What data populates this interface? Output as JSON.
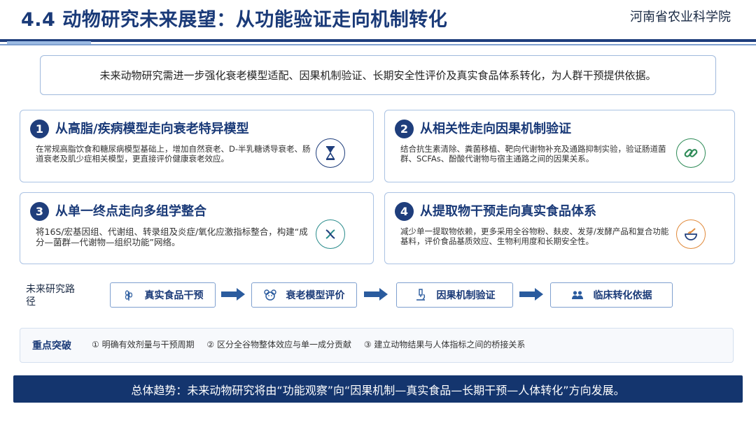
{
  "header": {
    "title": "4.4 动物研究未来展望：从功能验证走向机制转化",
    "org": "河南省农业科学院"
  },
  "intro": "未来动物研究需进一步强化衰老模型适配、因果机制验证、长期安全性评价及真实食品体系转化，为人群干预提供依据。",
  "cards": [
    {
      "number": "1",
      "title": "从高脂/疾病模型走向衰老特异模型",
      "body": "在常规高脂饮食和糖尿病模型基础上，增加自然衰老、D-半乳糖诱导衰老、肠道衰老及肌少症相关模型，更直接评价健康衰老效应。",
      "icon": "hourglass-icon"
    },
    {
      "number": "2",
      "title": "从相关性走向因果机制验证",
      "body": "结合抗生素清除、粪菌移植、靶向代谢物补充及通路抑制实验，验证肠道菌群、SCFAs、酚酸代谢物与宿主通路之间的因果关系。",
      "icon": "link-icon"
    },
    {
      "number": "3",
      "title": "从单一终点走向多组学整合",
      "body": "将16S/宏基因组、代谢组、转录组及炎症/氧化应激指标整合，构建“成分—菌群—代谢物—组织功能”网络。",
      "icon": "dna-icon"
    },
    {
      "number": "4",
      "title": "从提取物干预走向真实食品体系",
      "body": "减少单一提取物依赖，更多采用全谷物粉、麸皮、发芽/发酵产品和复合功能基料，评价食品基质效应、生物利用度和长期安全性。",
      "icon": "bowl-icon"
    }
  ],
  "path": {
    "label": "未来研究路径",
    "steps": [
      {
        "label": "真实食品干预",
        "icon": "grain-icon"
      },
      {
        "label": "衰老模型评价",
        "icon": "mouse-icon"
      },
      {
        "label": "因果机制验证",
        "icon": "microscope-icon"
      },
      {
        "label": "临床转化依据",
        "icon": "people-icon"
      }
    ]
  },
  "key": {
    "label": "重点突破",
    "items": [
      "① 明确有效剂量与干预周期",
      "② 区分全谷物整体效应与单一成分贡献",
      "③ 建立动物结果与人体指标之间的桥接关系"
    ]
  },
  "trend": "总体趋势：未来动物研究将由“功能观察”向“因果机制—真实食品—长期干预—人体转化”方向发展。",
  "colors": {
    "primary": "#1f3e7c",
    "border": "#aac2e3",
    "green": "#2e8b57",
    "teal": "#2a8c8c",
    "orange": "#e0893a",
    "trend_bg": "#14356e"
  }
}
